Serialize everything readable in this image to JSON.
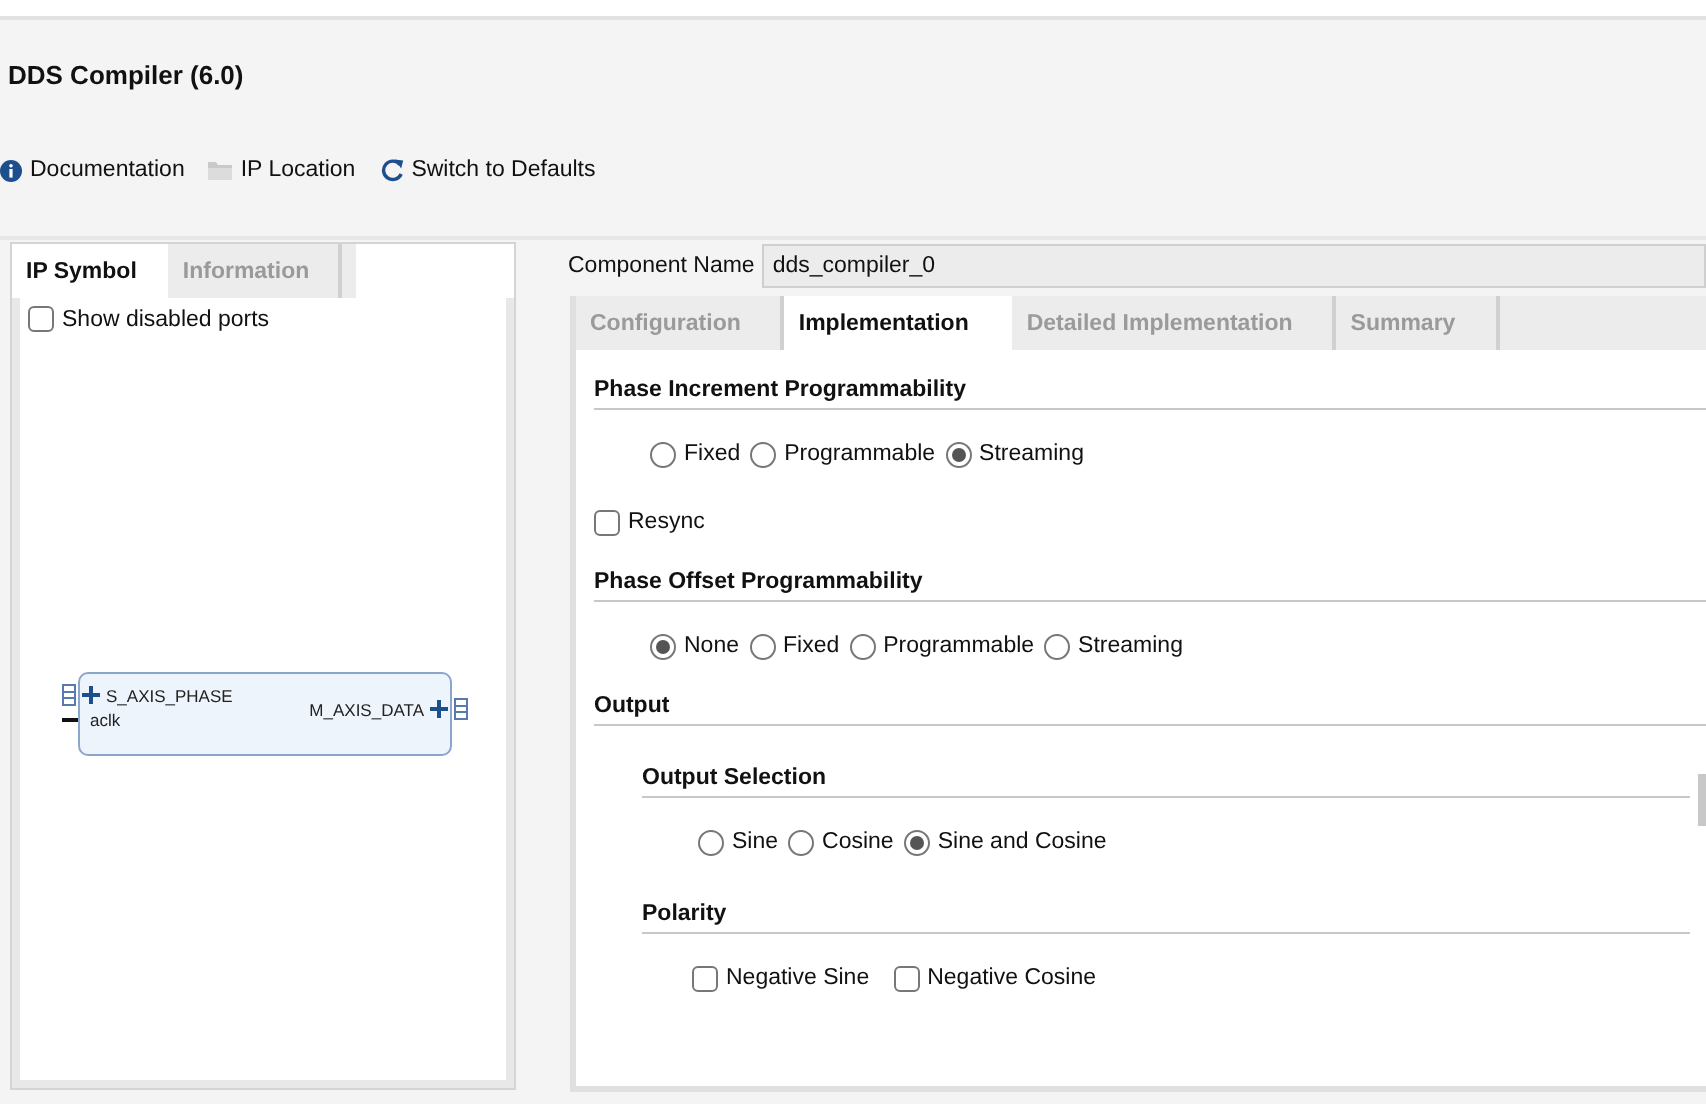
{
  "title": "DDS Compiler (6.0)",
  "toolbar": [
    {
      "kind": "info",
      "label": "Documentation"
    },
    {
      "kind": "folder",
      "label": "IP Location"
    },
    {
      "kind": "refresh",
      "label": "Switch to Defaults"
    }
  ],
  "left_panel": {
    "tabs": [
      {
        "label": "IP Symbol",
        "selected": true
      },
      {
        "label": "Information",
        "selected": false
      }
    ],
    "show_disabled_ports": {
      "label": "Show disabled ports",
      "checked": false
    },
    "symbol": {
      "left_ports": [
        {
          "kind": "bus",
          "label": "S_AXIS_PHASE"
        },
        {
          "kind": "wire",
          "label": "aclk"
        }
      ],
      "right_ports": [
        {
          "kind": "bus",
          "label": "M_AXIS_DATA"
        }
      ]
    }
  },
  "component_name": {
    "label": "Component Name",
    "value": "dds_compiler_0"
  },
  "tabs": [
    {
      "label": "Configuration",
      "selected": false
    },
    {
      "label": "Implementation",
      "selected": true
    },
    {
      "label": "Detailed Implementation",
      "selected": false
    },
    {
      "label": "Summary",
      "selected": false
    }
  ],
  "sections": [
    {
      "title": "Phase Increment Programmability",
      "children": [
        {
          "kind": "radios",
          "options": [
            {
              "label": "Fixed",
              "selected": false
            },
            {
              "label": "Programmable",
              "selected": false
            },
            {
              "label": "Streaming",
              "selected": true
            }
          ]
        },
        {
          "kind": "checkbox",
          "label": "Resync",
          "checked": false
        }
      ]
    },
    {
      "title": "Phase Offset Programmability",
      "children": [
        {
          "kind": "radios",
          "options": [
            {
              "label": "None",
              "selected": true
            },
            {
              "label": "Fixed",
              "selected": false
            },
            {
              "label": "Programmable",
              "selected": false
            },
            {
              "label": "Streaming",
              "selected": false
            }
          ]
        }
      ]
    },
    {
      "title": "Output",
      "children": [
        {
          "kind": "group",
          "title": "Output Selection",
          "children": [
            {
              "kind": "radios",
              "options": [
                {
                  "label": "Sine",
                  "selected": false
                },
                {
                  "label": "Cosine",
                  "selected": false
                },
                {
                  "label": "Sine and Cosine",
                  "selected": true
                }
              ]
            }
          ]
        },
        {
          "kind": "group",
          "title": "Polarity",
          "children": [
            {
              "kind": "checks",
              "options": [
                {
                  "label": "Negative Sine",
                  "checked": false
                },
                {
                  "label": "Negative Cosine",
                  "checked": false
                }
              ]
            }
          ]
        }
      ]
    }
  ]
}
